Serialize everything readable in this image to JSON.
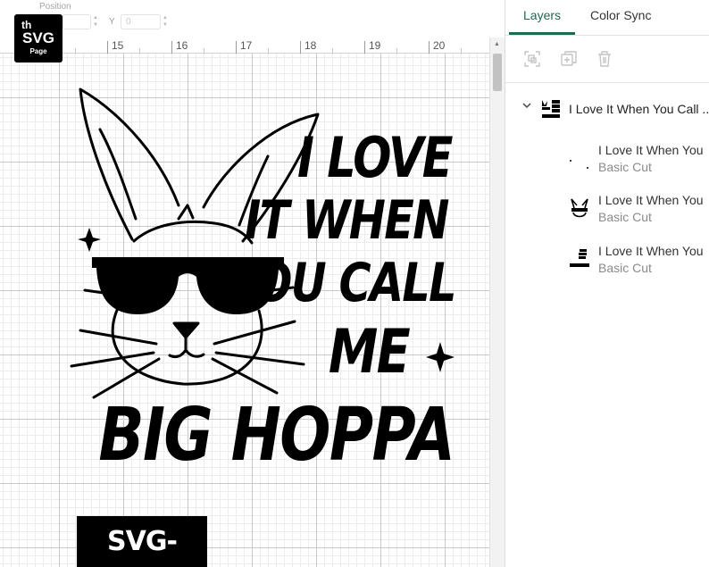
{
  "toolbar": {
    "position_label": "Position",
    "x_value": "",
    "y_label": "Y",
    "y_value": "0"
  },
  "ruler": {
    "ticks": [
      "15",
      "16",
      "17",
      "18",
      "19",
      "20"
    ]
  },
  "logo": {
    "line1": "th",
    "line2": "SVG",
    "line3": "Page"
  },
  "design": {
    "lines": [
      "I LOVE",
      "IT WHEN",
      "YOU CALL",
      "ME",
      "BIG HOPPA"
    ],
    "badge": "SVG-PNG"
  },
  "panel": {
    "tabs": {
      "layers": "Layers",
      "color_sync": "Color Sync"
    },
    "active_tab": "Layers",
    "accent_color": "#1c6b4f",
    "tool_icons": [
      "group-icon",
      "duplicate-icon",
      "delete-icon"
    ],
    "group": {
      "name": "I Love It When You Call ...",
      "expanded": true
    },
    "layers": [
      {
        "name": "I Love It When You",
        "type": "Basic Cut"
      },
      {
        "name": "I Love It When You",
        "type": "Basic Cut"
      },
      {
        "name": "I Love It When You",
        "type": "Basic Cut"
      }
    ]
  }
}
